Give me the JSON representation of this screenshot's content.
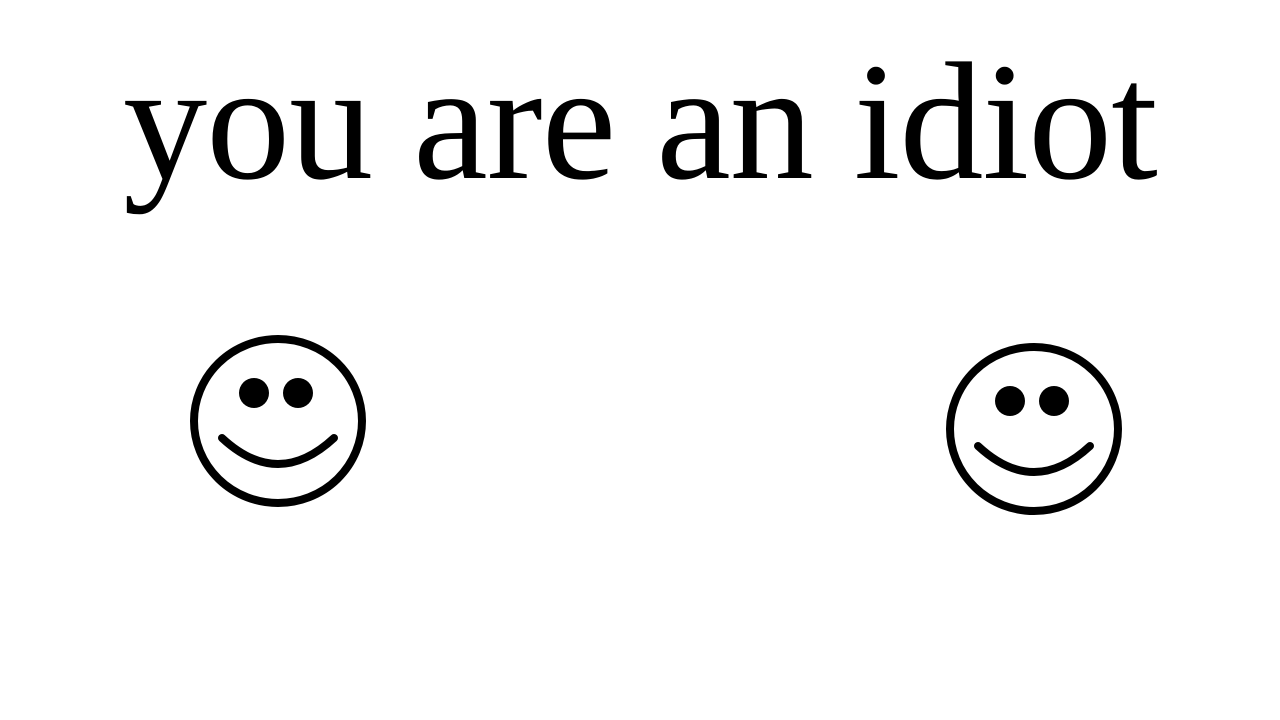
{
  "headline": {
    "text": "you are an idiot"
  },
  "colors": {
    "background": "#ffffff",
    "ink": "#000000"
  },
  "icons": [
    "smiley-face-icon",
    "smiley-face-icon"
  ]
}
